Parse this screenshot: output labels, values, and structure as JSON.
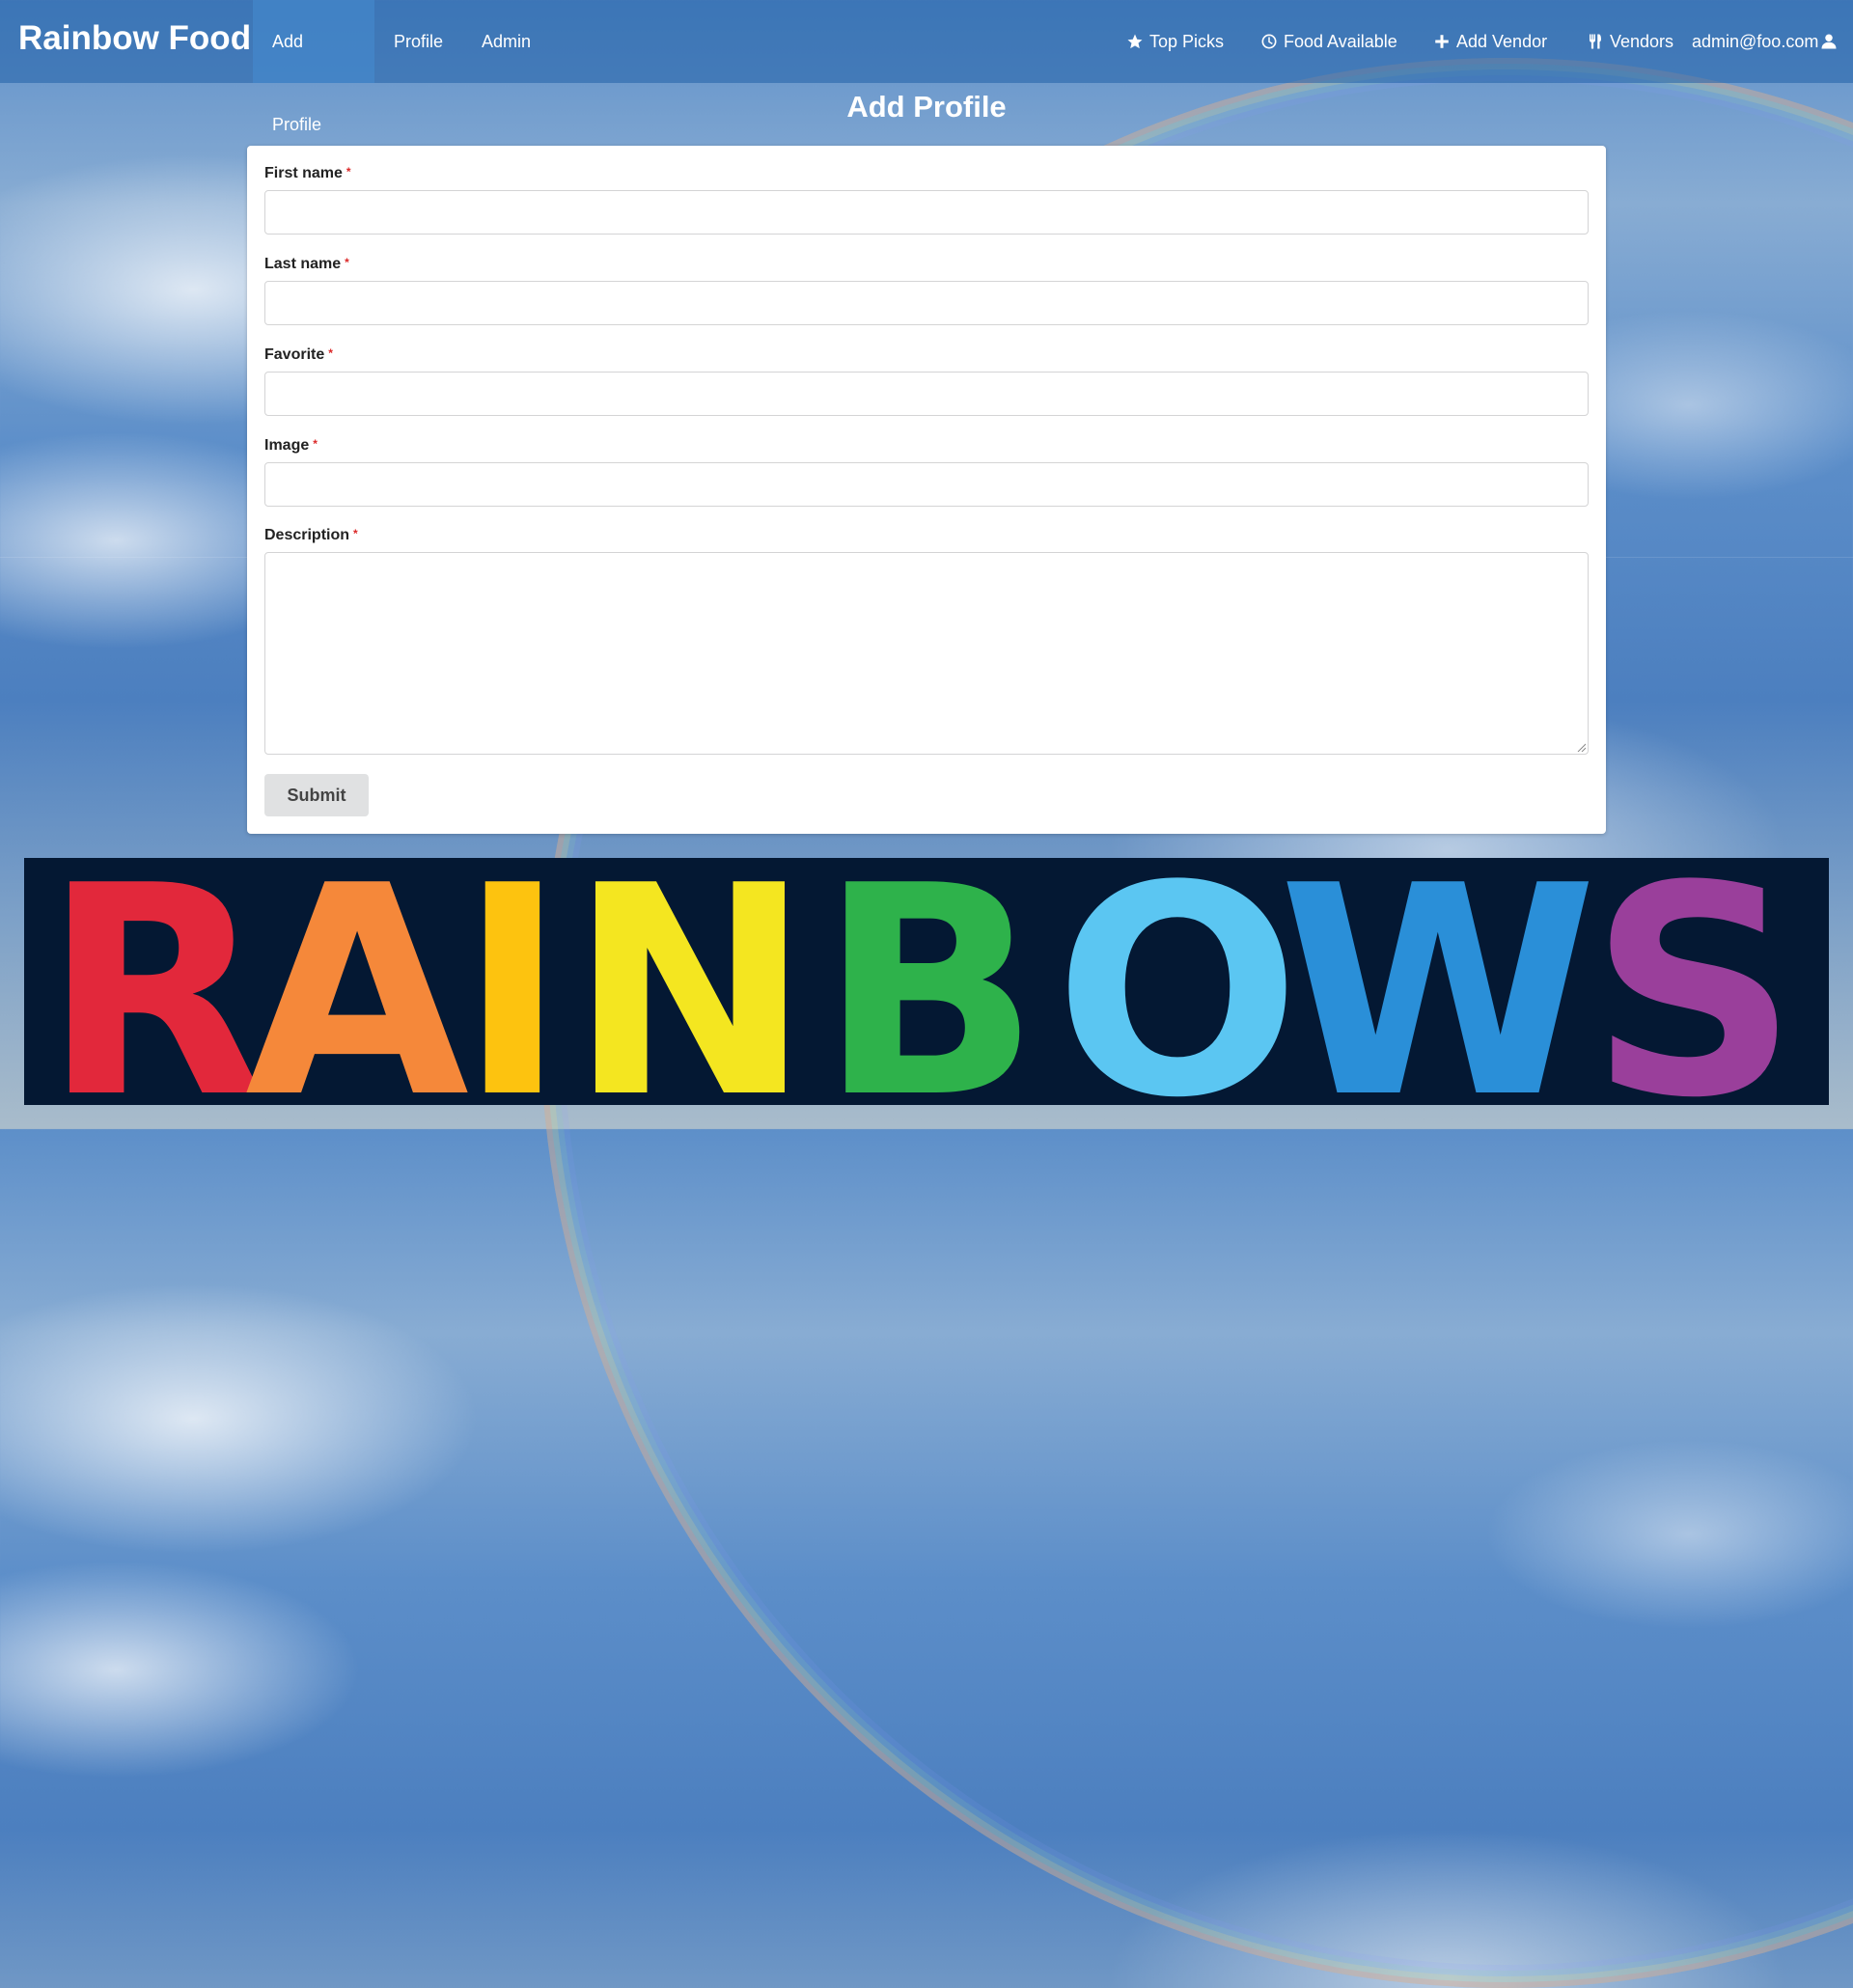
{
  "navbar": {
    "brand": "Rainbow Food",
    "left_links": [
      {
        "label": "Add Profile",
        "active": true
      },
      {
        "label": "Profile",
        "active": false
      },
      {
        "label": "Admin",
        "active": false
      }
    ],
    "right_links": [
      {
        "label": "Top Picks",
        "icon": "star-icon"
      },
      {
        "label": "Food Available",
        "icon": "clock-icon"
      },
      {
        "label": "Add Vendor",
        "icon": "plus-icon"
      },
      {
        "label": "Vendors",
        "icon": "utensils-icon"
      }
    ],
    "user": {
      "label": "admin@foo.com",
      "icon": "user-icon"
    }
  },
  "page": {
    "title": "Add Profile"
  },
  "form": {
    "fields": [
      {
        "label": "First name",
        "required": "*",
        "value": ""
      },
      {
        "label": "Last name",
        "required": "*",
        "value": ""
      },
      {
        "label": "Favorite",
        "required": "*",
        "value": ""
      },
      {
        "label": "Image",
        "required": "*",
        "value": ""
      },
      {
        "label": "Description",
        "required": "*",
        "value": ""
      }
    ],
    "submit_label": "Submit"
  },
  "banner": {
    "letters": [
      "R",
      "A",
      "I",
      "N",
      "B",
      "O",
      "W",
      "S"
    ],
    "colors": [
      "#e2283b",
      "#f5883a",
      "#fdc30f",
      "#f4e620",
      "#2eb24b",
      "#5bc6f2",
      "#2a8fd8",
      "#9a3f9b"
    ],
    "background": "#041833"
  },
  "colors": {
    "navbar_bg": "#2060a8",
    "required_star": "#db2828",
    "submit_bg": "#e0e1e2"
  }
}
